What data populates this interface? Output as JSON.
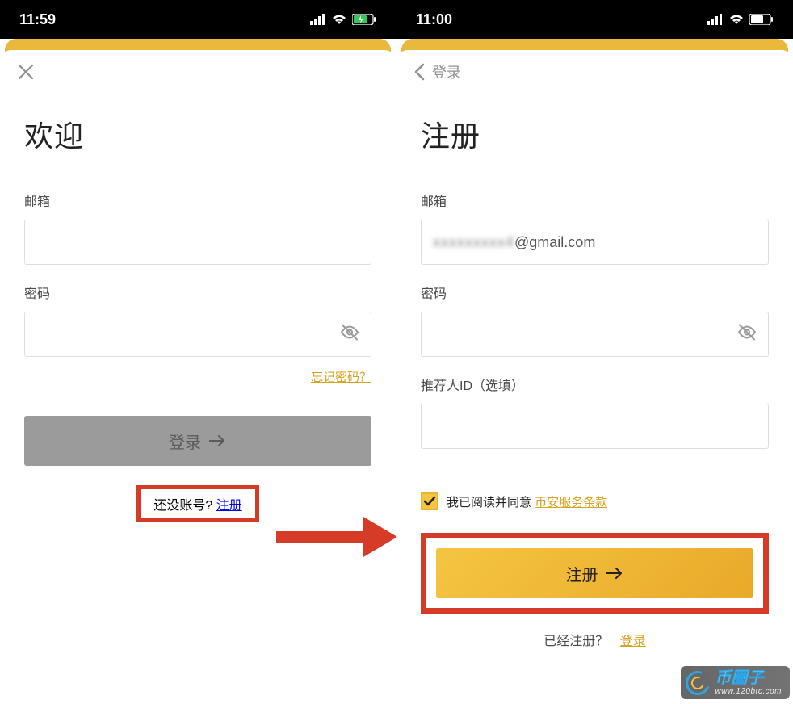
{
  "left": {
    "status_time": "11:59",
    "topbar_label": "",
    "title": "欢迎",
    "email_label": "邮箱",
    "password_label": "密码",
    "forgot_link": "忘记密码？",
    "login_button": "登录",
    "no_account_text": "还没账号?",
    "register_link": "注册"
  },
  "right": {
    "status_time": "11:00",
    "topbar_label": "登录",
    "title": "注册",
    "email_label": "邮箱",
    "email_value_suffix": "@gmail.com",
    "password_label": "密码",
    "referrer_label": "推荐人ID（选填）",
    "agree_text": "我已阅读并同意",
    "terms_link": "币安服务条款",
    "register_button": "注册",
    "already_text": "已经注册？",
    "login_link": "登录"
  },
  "watermark": {
    "zh": "币圈子",
    "en": "www.120btc.com"
  }
}
